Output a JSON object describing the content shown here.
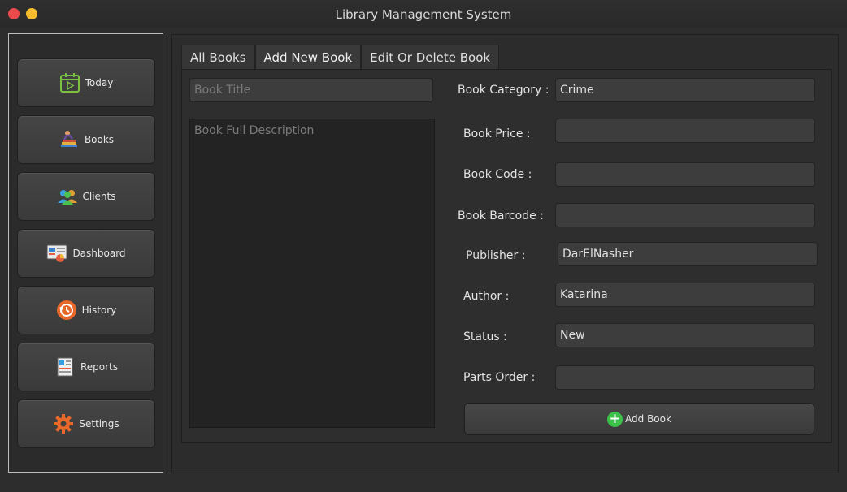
{
  "window": {
    "title": "Library Management System"
  },
  "sidebar": {
    "items": [
      {
        "label": "Today",
        "icon": "calendar-play-icon"
      },
      {
        "label": "Books",
        "icon": "books-reader-icon"
      },
      {
        "label": "Clients",
        "icon": "users-icon"
      },
      {
        "label": "Dashboard",
        "icon": "dashboard-chart-icon"
      },
      {
        "label": "History",
        "icon": "history-icon"
      },
      {
        "label": "Reports",
        "icon": "report-icon"
      },
      {
        "label": "Settings",
        "icon": "gear-icon"
      }
    ]
  },
  "tabs": [
    {
      "label": "All Books"
    },
    {
      "label": "Add New Book"
    },
    {
      "label": "Edit Or Delete Book"
    }
  ],
  "active_tab": "Add New Book",
  "form": {
    "title_placeholder": "Book Title",
    "title_value": "",
    "description_placeholder": "Book Full Description",
    "category_label": "Book Category :",
    "category_value": "Crime",
    "price_label": "Book Price :",
    "price_value": "",
    "code_label": "Book Code :",
    "code_value": "",
    "barcode_label": "Book Barcode :",
    "barcode_value": "",
    "publisher_label": "Publisher :",
    "publisher_value": "DarElNasher",
    "author_label": "Author :",
    "author_value": "Katarina",
    "status_label": "Status :",
    "status_value": "New",
    "parts_label": "Parts Order :",
    "parts_value": "",
    "add_button_label": "Add Book"
  },
  "colors": {
    "close": "#ec4b4b",
    "minimize": "#f5bd2e",
    "add_icon": "#3cc14a",
    "history_icon": "#e8682a",
    "settings_icon": "#e8682a",
    "today_icon": "#7cc242"
  }
}
